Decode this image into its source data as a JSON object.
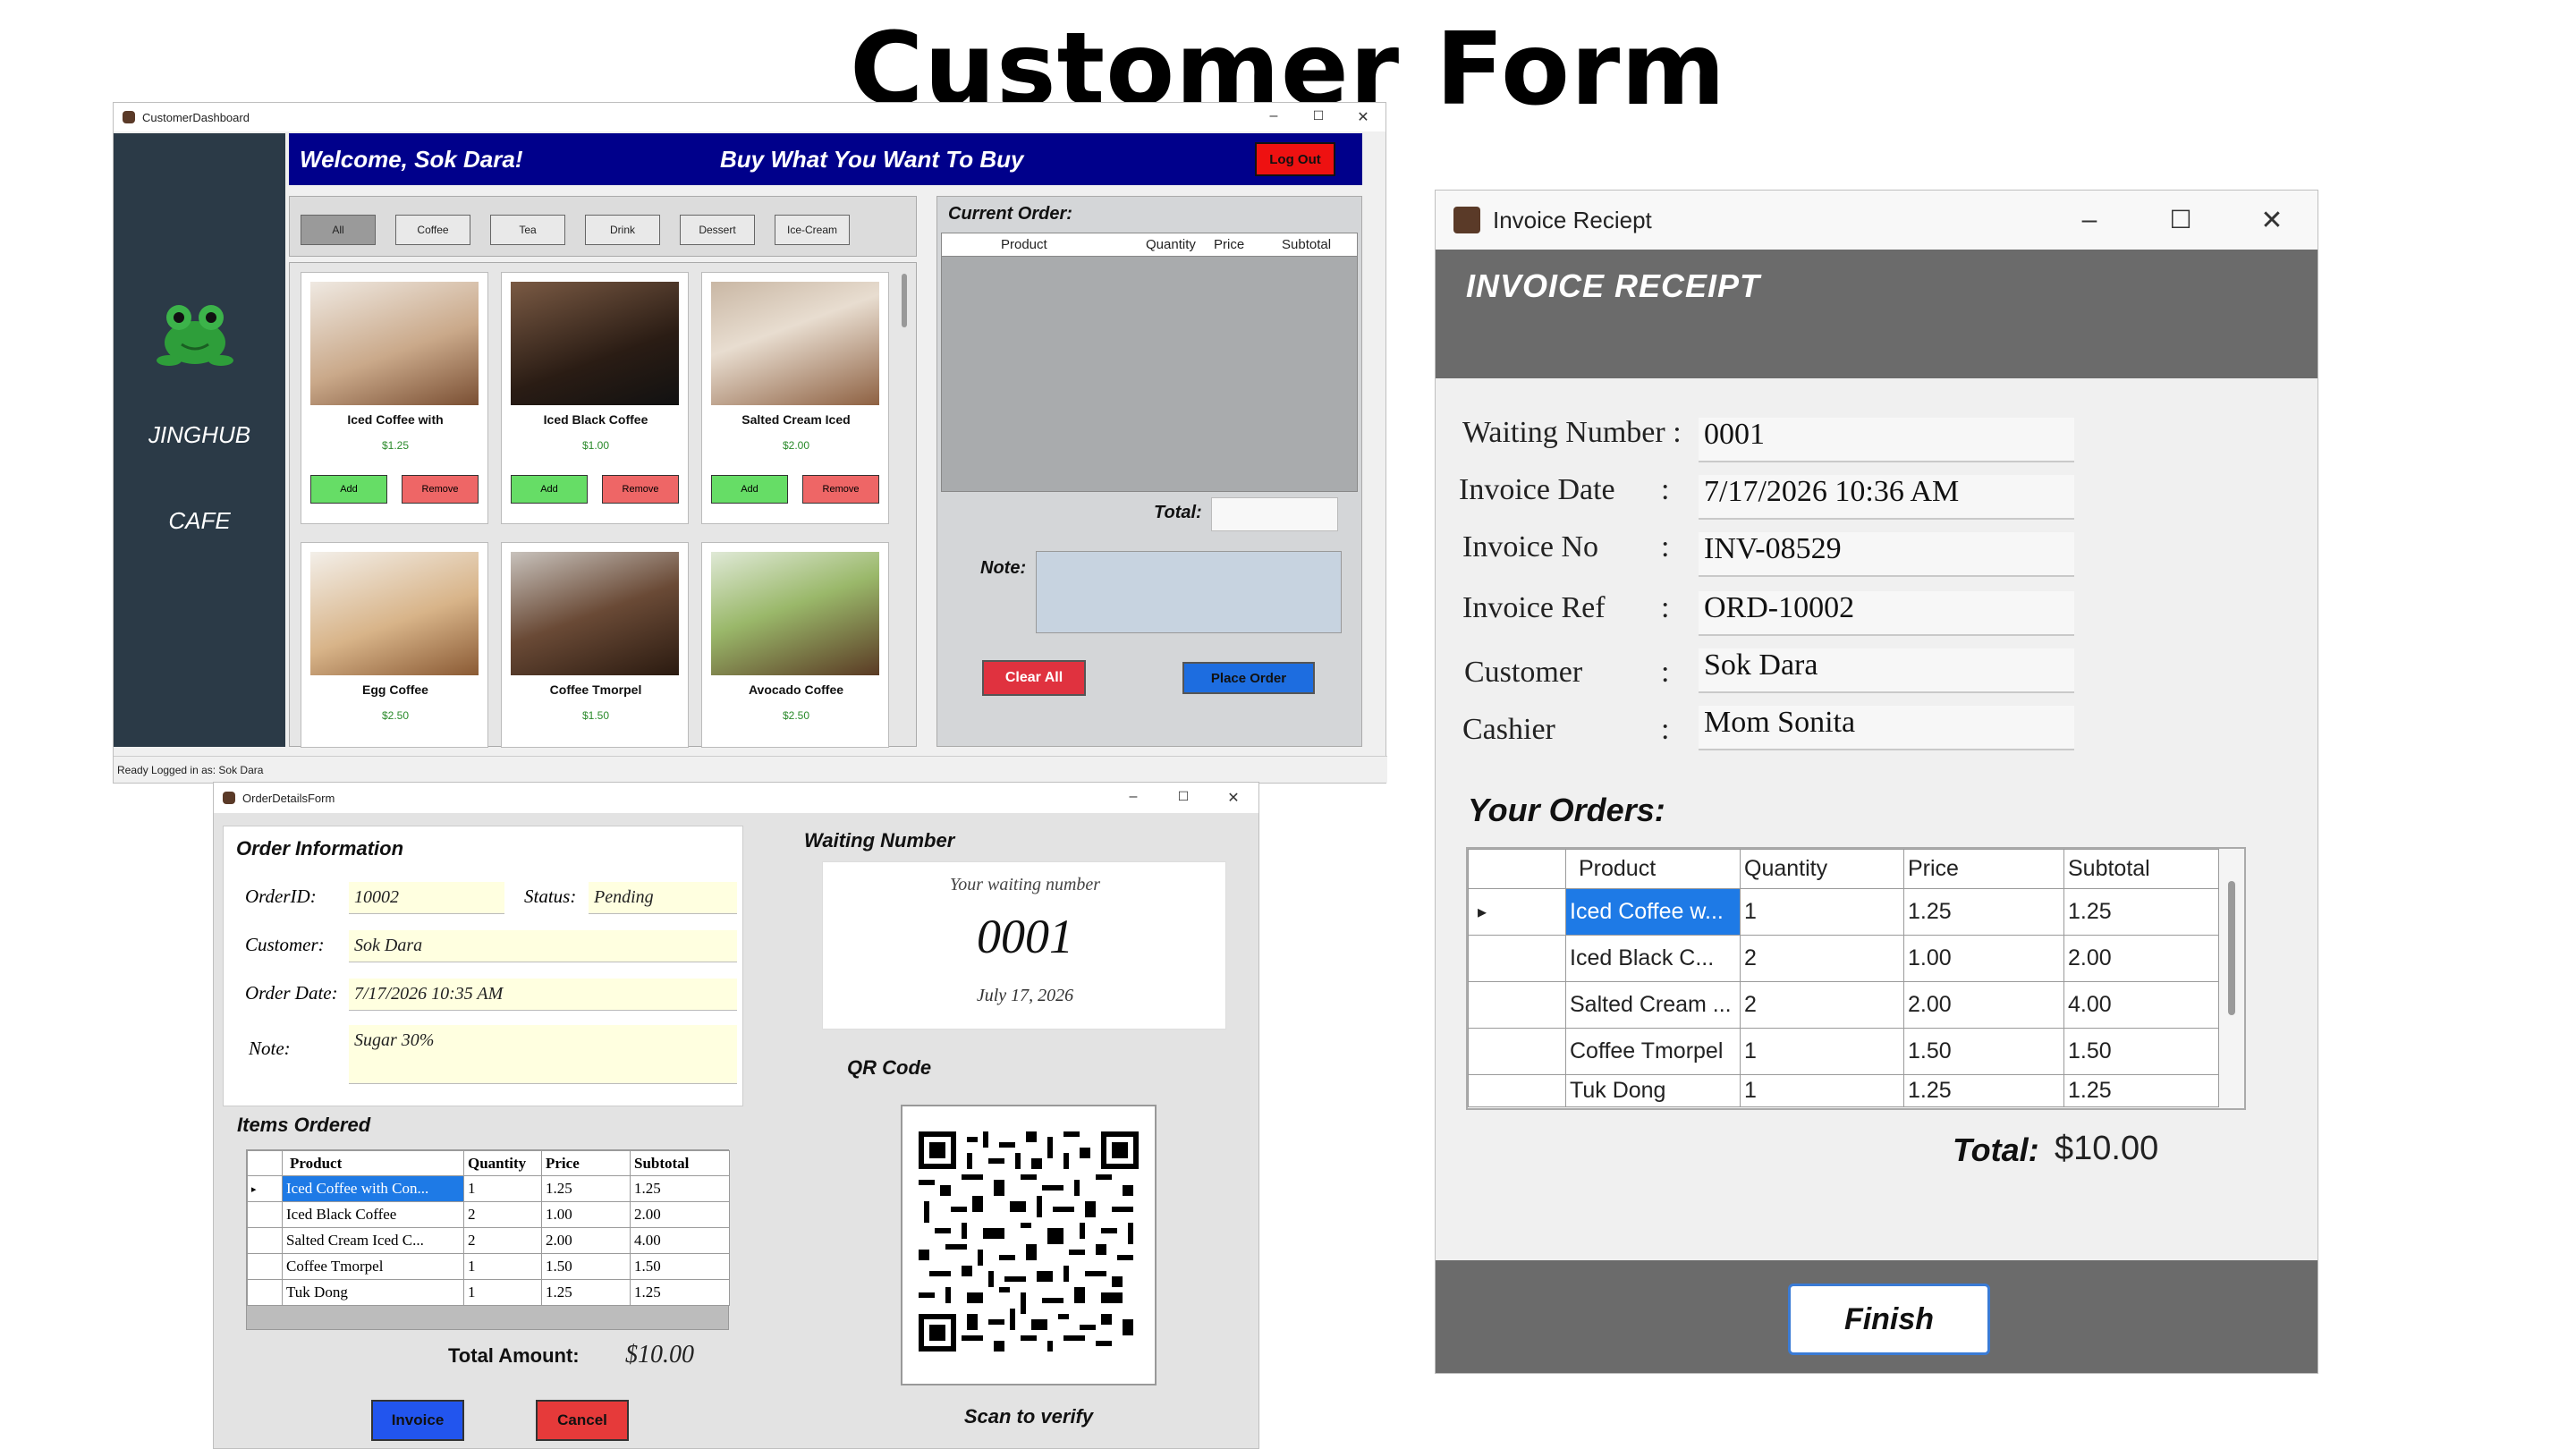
{
  "page": {
    "title": "Customer Form"
  },
  "dashboard": {
    "window_title": "CustomerDashboard",
    "welcome": "Welcome, Sok Dara!",
    "slogan": "Buy What You Want To Buy",
    "logout": "Log Out",
    "brand_line1": "JINGHUB",
    "brand_line2": "CAFE",
    "categories": [
      "All",
      "Coffee",
      "Tea",
      "Drink",
      "Dessert",
      "Ice-Cream"
    ],
    "products": [
      {
        "name": "Iced Coffee with",
        "price": "$1.25"
      },
      {
        "name": "Iced Black Coffee",
        "price": "$1.00"
      },
      {
        "name": "Salted Cream Iced",
        "price": "$2.00"
      },
      {
        "name": "Egg Coffee",
        "price": "$2.50"
      },
      {
        "name": "Coffee Tmorpel",
        "price": "$1.50"
      },
      {
        "name": "Avocado Coffee",
        "price": "$2.50"
      }
    ],
    "add_label": "Add",
    "remove_label": "Remove",
    "current_order_label": "Current Order:",
    "order_columns": [
      "Product",
      "Quantity",
      "Price",
      "Subtotal"
    ],
    "total_label": "Total:",
    "note_label": "Note:",
    "clear_all": "Clear All",
    "place_order": "Place Order",
    "status_bar": "Ready  Logged in as: Sok Dara"
  },
  "order_details": {
    "window_title": "OrderDetailsForm",
    "section_title": "Order Information",
    "order_id_label": "OrderID:",
    "order_id": "10002",
    "status_label": "Status:",
    "status": "Pending",
    "customer_label": "Customer:",
    "customer": "Sok Dara",
    "order_date_label": "Order Date:",
    "order_date": "7/17/2026 10:35 AM",
    "note_label": "Note:",
    "note": "Sugar 30%",
    "waiting_title": "Waiting Number",
    "waiting_caption": "Your waiting number",
    "waiting_number": "0001",
    "waiting_date": "July 17, 2026",
    "qr_title": "QR Code",
    "qr_caption": "Scan to verify",
    "items_title": "Items Ordered",
    "items_columns": [
      "Product",
      "Quantity",
      "Price",
      "Subtotal"
    ],
    "items": [
      [
        "Iced Coffee with Con...",
        "1",
        "1.25",
        "1.25"
      ],
      [
        "Iced Black Coffee",
        "2",
        "1.00",
        "2.00"
      ],
      [
        "Salted Cream Iced C...",
        "2",
        "2.00",
        "4.00"
      ],
      [
        "Coffee Tmorpel",
        "1",
        "1.50",
        "1.50"
      ],
      [
        "Tuk Dong",
        "1",
        "1.25",
        "1.25"
      ]
    ],
    "total_label": "Total Amount:",
    "total": "$10.00",
    "invoice_btn": "Invoice",
    "cancel_btn": "Cancel"
  },
  "invoice": {
    "window_title": "Invoice Reciept",
    "header": "INVOICE RECEIPT",
    "fields": [
      {
        "label": "Waiting Number :",
        "value": "0001"
      },
      {
        "label": "Invoice Date",
        "value": "7/17/2026 10:36 AM"
      },
      {
        "label": "Invoice No",
        "value": "INV-08529"
      },
      {
        "label": "Invoice Ref",
        "value": "ORD-10002"
      },
      {
        "label": "Customer",
        "value": "Sok Dara"
      },
      {
        "label": "Cashier",
        "value": "Mom Sonita"
      }
    ],
    "colon": ":",
    "orders_title": "Your Orders:",
    "columns": [
      "Product",
      "Quantity",
      "Price",
      "Subtotal"
    ],
    "rows": [
      [
        "Iced Coffee w...",
        "1",
        "1.25",
        "1.25"
      ],
      [
        "Iced Black C...",
        "2",
        "1.00",
        "2.00"
      ],
      [
        "Salted Cream ...",
        "2",
        "2.00",
        "4.00"
      ],
      [
        "Coffee Tmorpel",
        "1",
        "1.50",
        "1.50"
      ],
      [
        "Tuk Dong",
        "1",
        "1.25",
        "1.25"
      ]
    ],
    "total_label": "Total:",
    "total": "$10.00",
    "finish": "Finish"
  },
  "colors": {
    "banner": "#00008b",
    "sidebar": "#2b3a47",
    "invoice_header": "#6b6b6b",
    "selected_row": "#1e7ae6"
  }
}
